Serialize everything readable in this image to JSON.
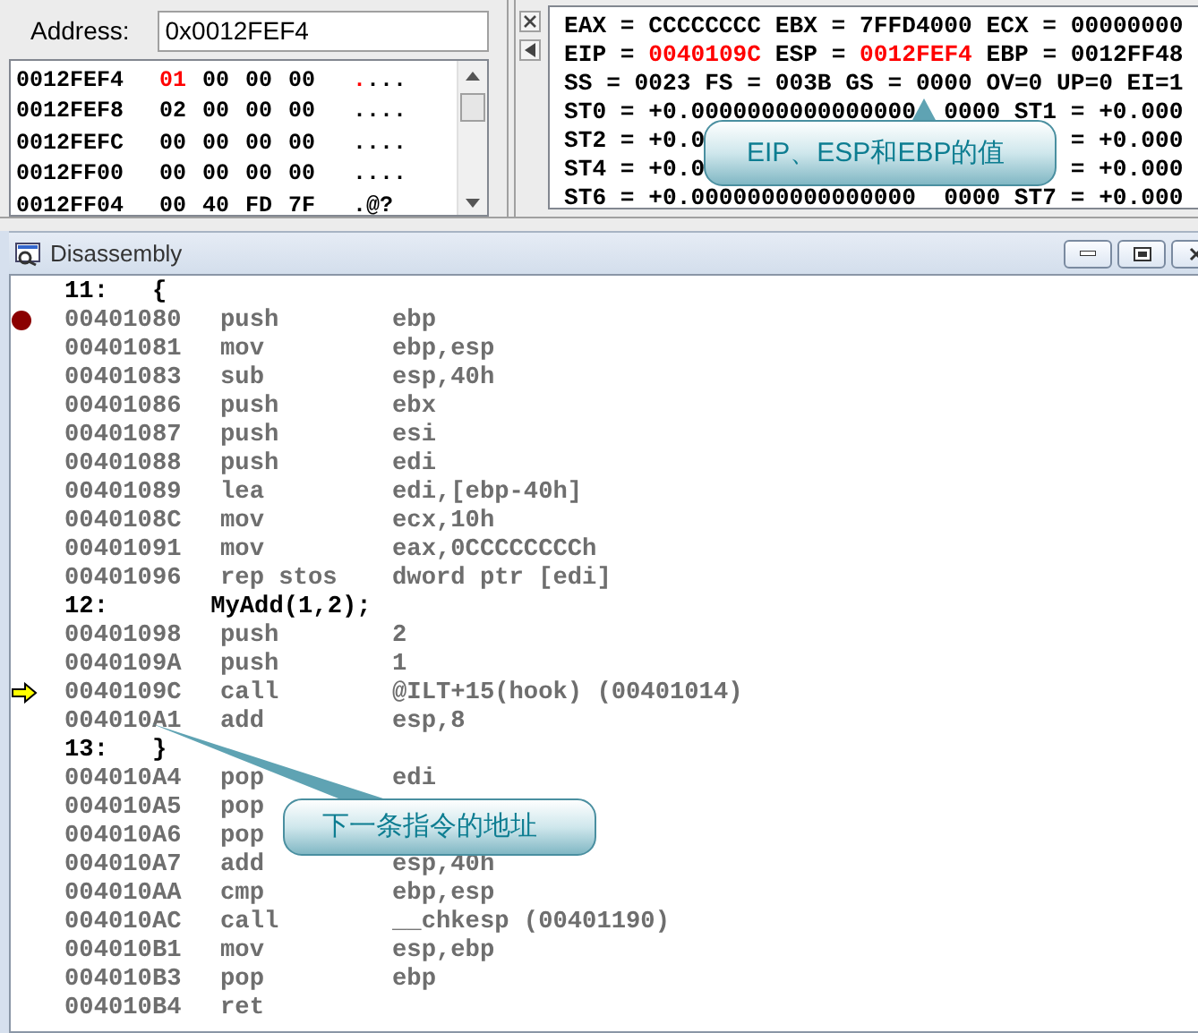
{
  "memory": {
    "address_label": "Address:",
    "address_value": "0x0012FEF4",
    "rows": [
      {
        "address": "0012FEF4",
        "bytes": [
          {
            "value": "01",
            "changed": true
          },
          {
            "value": "00",
            "changed": false
          },
          {
            "value": "00",
            "changed": false
          },
          {
            "value": "00",
            "changed": false
          }
        ],
        "ascii": [
          {
            "text": ".",
            "changed": true
          },
          {
            "text": "...",
            "changed": false
          }
        ]
      },
      {
        "address": "0012FEF8",
        "bytes": [
          {
            "value": "02",
            "changed": false
          },
          {
            "value": "00",
            "changed": false
          },
          {
            "value": "00",
            "changed": false
          },
          {
            "value": "00",
            "changed": false
          }
        ],
        "ascii": [
          {
            "text": "....",
            "changed": false
          }
        ]
      },
      {
        "address": "0012FEFC",
        "bytes": [
          {
            "value": "00",
            "changed": false
          },
          {
            "value": "00",
            "changed": false
          },
          {
            "value": "00",
            "changed": false
          },
          {
            "value": "00",
            "changed": false
          }
        ],
        "ascii": [
          {
            "text": "....",
            "changed": false
          }
        ]
      },
      {
        "address": "0012FF00",
        "bytes": [
          {
            "value": "00",
            "changed": false
          },
          {
            "value": "00",
            "changed": false
          },
          {
            "value": "00",
            "changed": false
          },
          {
            "value": "00",
            "changed": false
          }
        ],
        "ascii": [
          {
            "text": "....",
            "changed": false
          }
        ]
      },
      {
        "address": "0012FF04",
        "bytes": [
          {
            "value": "00",
            "changed": false
          },
          {
            "value": "40",
            "changed": false
          },
          {
            "value": "FD",
            "changed": false
          },
          {
            "value": "7F",
            "changed": false
          }
        ],
        "ascii": [
          {
            "text": ".@?",
            "changed": false
          }
        ]
      }
    ]
  },
  "registers": {
    "rows": [
      {
        "segments": [
          {
            "text": "EAX = CCCCCCCC EBX = 7FFD4000 ECX = 00000000",
            "changed": false
          }
        ]
      },
      {
        "segments": [
          {
            "text": "EIP = ",
            "changed": false
          },
          {
            "text": "0040109C",
            "changed": true
          },
          {
            "text": " ESP = ",
            "changed": false
          },
          {
            "text": "0012FEF4",
            "changed": true
          },
          {
            "text": " EBP = 0012FF48",
            "changed": false
          }
        ]
      },
      {
        "segments": [
          {
            "text": "SS = 0023 FS = 003B GS = 0000 OV=0 UP=0 EI=1",
            "changed": false
          }
        ]
      },
      {
        "segments": [
          {
            "text": "ST0 = +0.0000000000000000",
            "changed": false
          },
          {
            "text": "0000 ST1 = +0.000",
            "changed": false
          }
        ]
      },
      {
        "segments": [
          {
            "text": "ST2 = +0.0",
            "changed": false
          },
          {
            "text": "= +0.000",
            "changed": false
          }
        ]
      },
      {
        "segments": [
          {
            "text": "ST4 = +0.0",
            "changed": false
          },
          {
            "text": "= +0.000",
            "changed": false
          }
        ]
      },
      {
        "segments": [
          {
            "text": "ST6 = +0.0000000000000000",
            "changed": false
          },
          {
            "text": "0000 ST7 = +0.000",
            "changed": false
          }
        ]
      }
    ]
  },
  "disassembly": {
    "title": "Disassembly",
    "lines": [
      {
        "kind": "source",
        "text": "11:   {"
      },
      {
        "kind": "asm",
        "breakpoint": true,
        "current": false,
        "address": "00401080",
        "mnemonic": "push",
        "operand": "ebp"
      },
      {
        "kind": "asm",
        "breakpoint": false,
        "current": false,
        "address": "00401081",
        "mnemonic": "mov",
        "operand": "ebp,esp"
      },
      {
        "kind": "asm",
        "breakpoint": false,
        "current": false,
        "address": "00401083",
        "mnemonic": "sub",
        "operand": "esp,40h"
      },
      {
        "kind": "asm",
        "breakpoint": false,
        "current": false,
        "address": "00401086",
        "mnemonic": "push",
        "operand": "ebx"
      },
      {
        "kind": "asm",
        "breakpoint": false,
        "current": false,
        "address": "00401087",
        "mnemonic": "push",
        "operand": "esi"
      },
      {
        "kind": "asm",
        "breakpoint": false,
        "current": false,
        "address": "00401088",
        "mnemonic": "push",
        "operand": "edi"
      },
      {
        "kind": "asm",
        "breakpoint": false,
        "current": false,
        "address": "00401089",
        "mnemonic": "lea",
        "operand": "edi,[ebp-40h]"
      },
      {
        "kind": "asm",
        "breakpoint": false,
        "current": false,
        "address": "0040108C",
        "mnemonic": "mov",
        "operand": "ecx,10h"
      },
      {
        "kind": "asm",
        "breakpoint": false,
        "current": false,
        "address": "00401091",
        "mnemonic": "mov",
        "operand": "eax,0CCCCCCCCh"
      },
      {
        "kind": "asm",
        "breakpoint": false,
        "current": false,
        "address": "00401096",
        "mnemonic": "rep stos",
        "operand": "dword ptr [edi]"
      },
      {
        "kind": "source",
        "text": "12:       MyAdd(1,2);"
      },
      {
        "kind": "asm",
        "breakpoint": false,
        "current": false,
        "address": "00401098",
        "mnemonic": "push",
        "operand": "2"
      },
      {
        "kind": "asm",
        "breakpoint": false,
        "current": false,
        "address": "0040109A",
        "mnemonic": "push",
        "operand": "1"
      },
      {
        "kind": "asm",
        "breakpoint": false,
        "current": true,
        "address": "0040109C",
        "mnemonic": "call",
        "operand": "@ILT+15(hook) (00401014)"
      },
      {
        "kind": "asm",
        "breakpoint": false,
        "current": false,
        "address": "004010A1",
        "mnemonic": "add",
        "operand": "esp,8"
      },
      {
        "kind": "source",
        "text": "13:   }"
      },
      {
        "kind": "asm",
        "breakpoint": false,
        "current": false,
        "address": "004010A4",
        "mnemonic": "pop",
        "operand": "edi"
      },
      {
        "kind": "asm",
        "breakpoint": false,
        "current": false,
        "address": "004010A5",
        "mnemonic": "pop"
      },
      {
        "kind": "asm",
        "breakpoint": false,
        "current": false,
        "address": "004010A6",
        "mnemonic": "pop"
      },
      {
        "kind": "asm",
        "breakpoint": false,
        "current": false,
        "address": "004010A7",
        "mnemonic": "add",
        "operand": "esp,40h"
      },
      {
        "kind": "asm",
        "breakpoint": false,
        "current": false,
        "address": "004010AA",
        "mnemonic": "cmp",
        "operand": "ebp,esp"
      },
      {
        "kind": "asm",
        "breakpoint": false,
        "current": false,
        "address": "004010AC",
        "mnemonic": "call",
        "operand": "__chkesp (00401190)"
      },
      {
        "kind": "asm",
        "breakpoint": false,
        "current": false,
        "address": "004010B1",
        "mnemonic": "mov",
        "operand": "esp,ebp"
      },
      {
        "kind": "asm",
        "breakpoint": false,
        "current": false,
        "address": "004010B3",
        "mnemonic": "pop",
        "operand": "ebp"
      },
      {
        "kind": "asm",
        "breakpoint": false,
        "current": false,
        "address": "004010B4",
        "mnemonic": "ret"
      }
    ]
  },
  "callouts": [
    {
      "text": "EIP、ESP和EBP的值"
    },
    {
      "text": "下一条指令的地址"
    }
  ]
}
